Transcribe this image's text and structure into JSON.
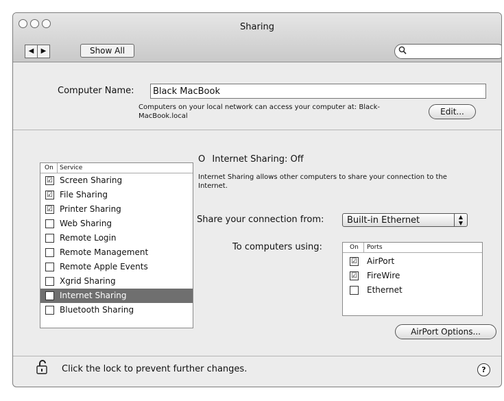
{
  "window": {
    "title": "Sharing",
    "nav_back_glyph": "◀",
    "nav_forward_glyph": "▶",
    "show_all_label": "Show All",
    "search_placeholder": ""
  },
  "computer_name": {
    "label": "Computer Name:",
    "value": "Black MacBook",
    "description_line1": "Computers on your local network can access your computer at: Black-",
    "description_line2": "MacBook.local",
    "edit_label": "Edit..."
  },
  "services": {
    "header_on": "On",
    "header_service": "Service",
    "items": [
      {
        "label": "Screen Sharing",
        "checked": "☑"
      },
      {
        "label": "File Sharing",
        "checked": "☑"
      },
      {
        "label": "Printer Sharing",
        "checked": "☑"
      },
      {
        "label": "Web Sharing",
        "checked": ""
      },
      {
        "label": "Remote Login",
        "checked": ""
      },
      {
        "label": "Remote Management",
        "checked": ""
      },
      {
        "label": "Remote Apple Events",
        "checked": ""
      },
      {
        "label": "Xgrid Sharing",
        "checked": ""
      },
      {
        "label": "Internet Sharing",
        "checked": ""
      },
      {
        "label": "Bluetooth Sharing",
        "checked": ""
      }
    ],
    "selected": "Internet Sharing"
  },
  "internet_sharing": {
    "status": "Internet Sharing: Off",
    "status_indicator": "O",
    "description_line1": "Internet Sharing allows other computers to share your connection to the",
    "description_line2": "Internet.",
    "share_from_label": "Share your connection from:",
    "share_from_value": "Built-in Ethernet",
    "to_computers_label": "To computers using:",
    "ports_header_on": "On",
    "ports_header_ports": "Ports",
    "ports": [
      {
        "label": "AirPort",
        "checked": "☑"
      },
      {
        "label": "FireWire",
        "checked": "☑"
      },
      {
        "label": "Ethernet",
        "checked": ""
      }
    ],
    "airport_options_label": "AirPort Options..."
  },
  "footer": {
    "lock_text": "Click the lock to prevent further changes.",
    "help_glyph": "?"
  },
  "colors": {
    "selection": "#6f6f6f",
    "window_bg": "#ececec"
  }
}
